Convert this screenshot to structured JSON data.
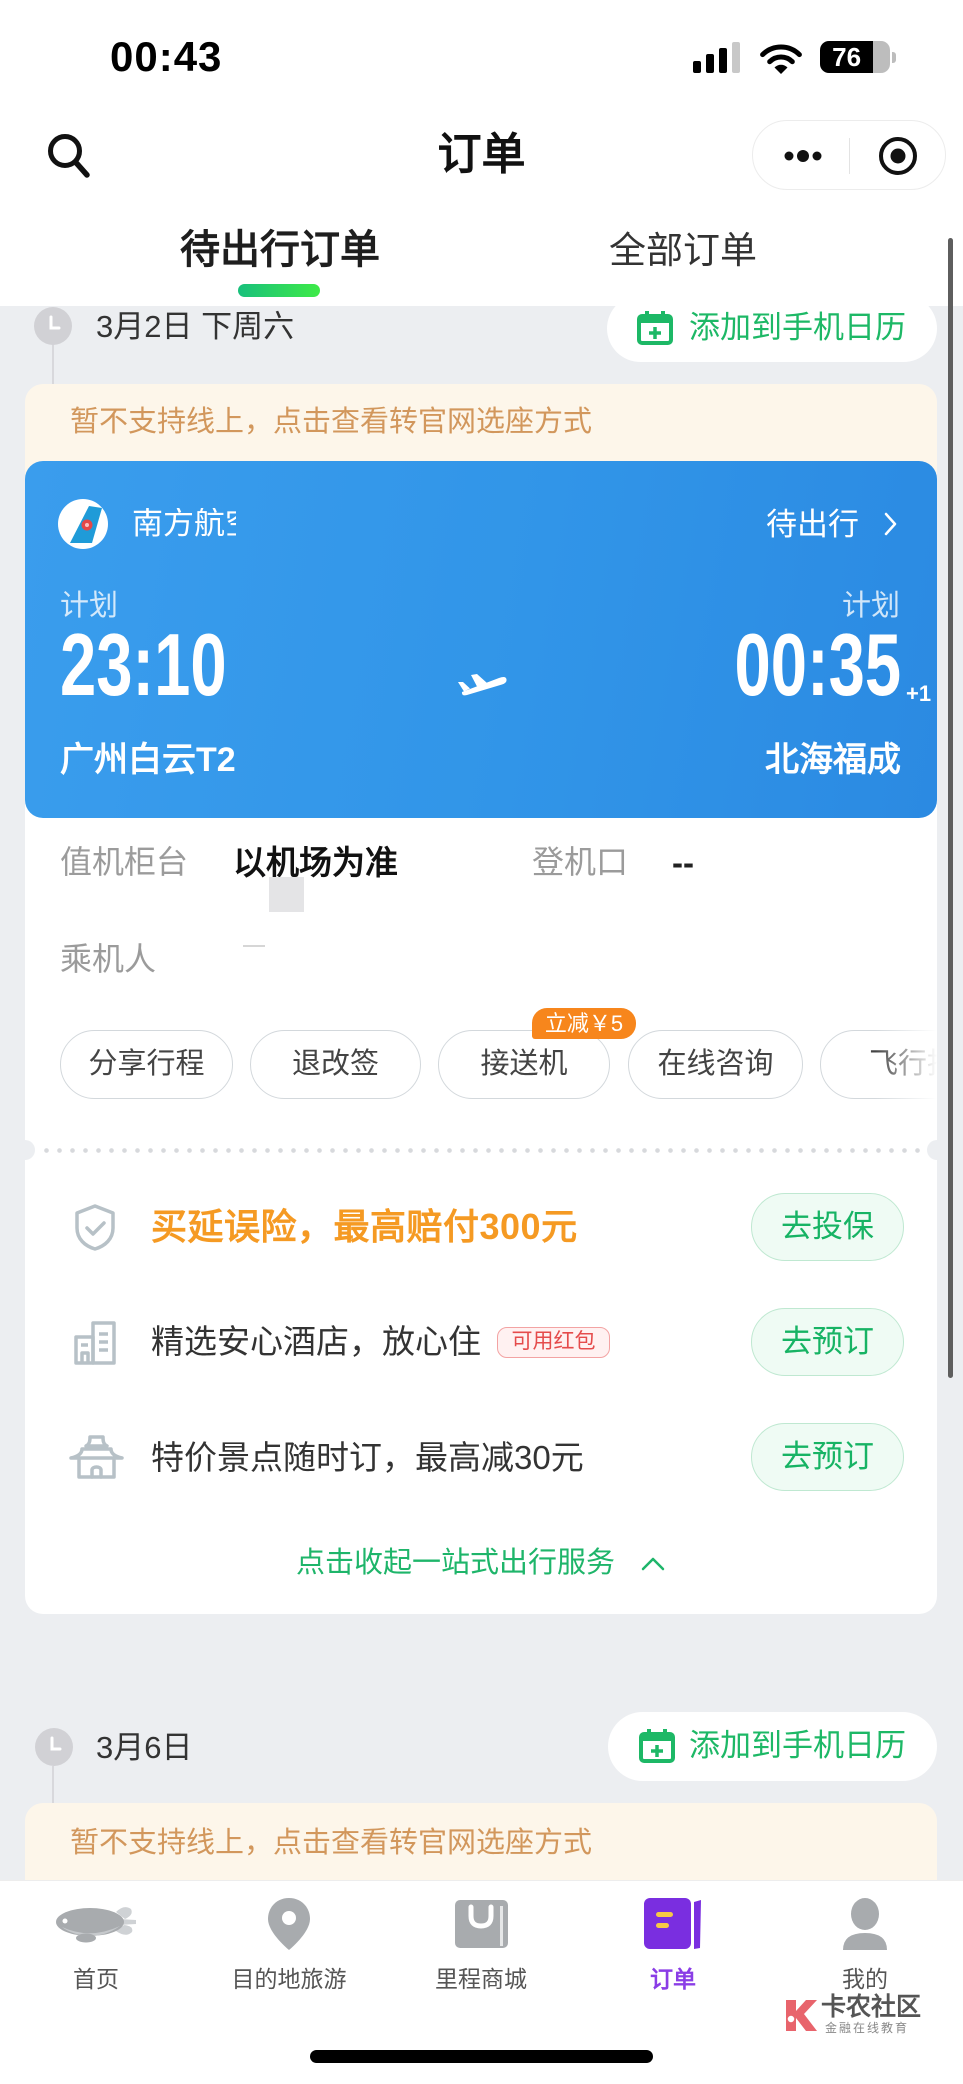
{
  "status_bar": {
    "time": "00:43",
    "battery_percent": "76",
    "battery_level": 0.76,
    "signal_bars_active": 3,
    "signal_bars_total": 4
  },
  "nav_bar": {
    "title": "订单",
    "left_icon": "search-icon",
    "capsule_icons": [
      "more-dots-icon",
      "target-icon"
    ]
  },
  "tabs": [
    {
      "label": "待出行订单",
      "active": true
    },
    {
      "label": "全部订单",
      "active": false
    }
  ],
  "orders": [
    {
      "date": "3月2日 下周六",
      "calendar_button": {
        "label": "添加到手机日历",
        "icon": "calendar-add-icon"
      },
      "notice": "暂不支持线上，点击查看转官网选座方式",
      "flight": {
        "airline": "南方航空",
        "status": "待出行",
        "departure": {
          "label": "计划",
          "time": "23:10",
          "airport": "广州白云T2"
        },
        "arrival": {
          "label": "计划",
          "time": "00:35",
          "day_offset": "+1",
          "airport": "北海福成"
        }
      },
      "details": {
        "checkin_label": "值机柜台",
        "checkin_value": "以机场为准",
        "gate_label": "登机口",
        "gate_value": "--",
        "passenger_label": "乘机人"
      },
      "actions": [
        {
          "label": "分享行程"
        },
        {
          "label": "退改签"
        },
        {
          "label": "接送机",
          "badge": "立减￥5"
        },
        {
          "label": "在线咨询"
        },
        {
          "label": "飞行指"
        }
      ],
      "services": [
        {
          "icon": "shield-check-icon",
          "text": "买延误险，最高赔付300元",
          "button": "去投保",
          "highlight": true
        },
        {
          "icon": "hotel-building-icon",
          "text": "精选安心酒店，放心住",
          "badge": "可用红包",
          "button": "去预订"
        },
        {
          "icon": "attraction-gate-icon",
          "text": "特价景点随时订，最高减30元",
          "button": "去预订"
        }
      ],
      "collapse_label": "点击收起一站式出行服务"
    },
    {
      "date": "3月6日",
      "calendar_button": {
        "label": "添加到手机日历",
        "icon": "calendar-add-icon"
      },
      "notice": "暂不支持线上，点击查看转官网选座方式"
    }
  ],
  "bottom_nav": [
    {
      "label": "首页",
      "icon": "blimp-icon",
      "active": false
    },
    {
      "label": "目的地旅游",
      "icon": "location-pin-icon",
      "active": false
    },
    {
      "label": "里程商城",
      "icon": "shopping-bag-icon",
      "active": false
    },
    {
      "label": "订单",
      "icon": "order-book-icon",
      "active": true
    },
    {
      "label": "我的",
      "icon": "user-icon",
      "active": false
    }
  ],
  "watermark": {
    "title": "卡农社区",
    "subtitle": "金融在线教育"
  },
  "colors": {
    "accent_green": "#1db866",
    "active_purple": "#8a3de6",
    "card_blue": "#3195e8",
    "notice_bg": "#fdf6ea",
    "notice_text": "#d2975c",
    "insurance_orange": "#f59a23",
    "promo_badge_orange": "#f7861c",
    "red_badge": "#e54b4b"
  }
}
